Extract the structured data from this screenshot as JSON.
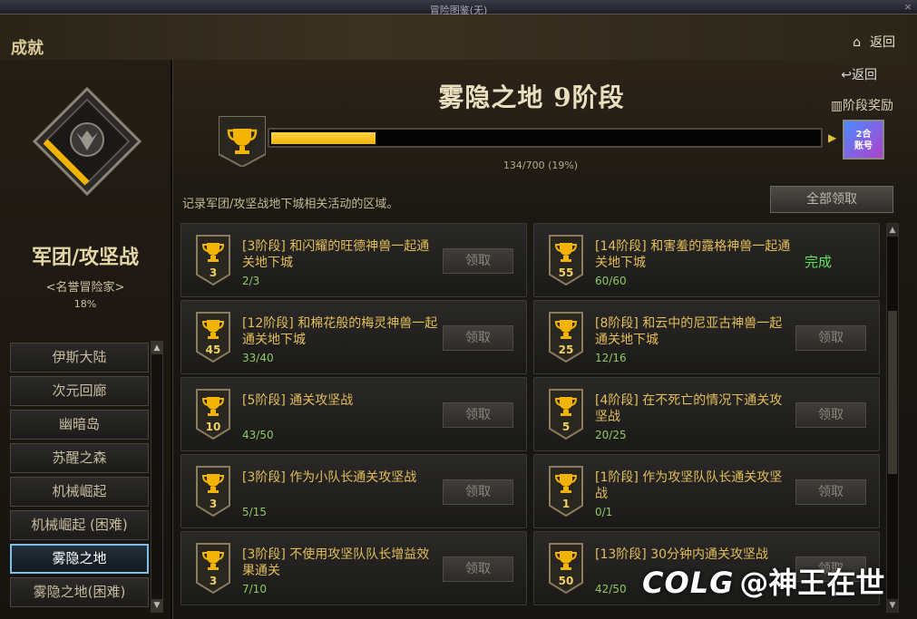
{
  "window": {
    "title": "冒险图鉴(无)",
    "close": "×"
  },
  "header": {
    "section_title": "成就",
    "home_label": "返回",
    "home_icon": "home-icon"
  },
  "category": {
    "title": "军团/攻坚战",
    "subtitle": "<名誉冒险家>",
    "percent": "18%",
    "items": [
      {
        "label": "伊斯大陆",
        "active": false
      },
      {
        "label": "次元回廊",
        "active": false
      },
      {
        "label": "幽暗岛",
        "active": false
      },
      {
        "label": "苏醒之森",
        "active": false
      },
      {
        "label": "机械崛起",
        "active": false
      },
      {
        "label": "机械崛起 (困难)",
        "active": false
      },
      {
        "label": "雾隐之地",
        "active": true
      },
      {
        "label": "雾隐之地(困难)",
        "active": false
      }
    ]
  },
  "main": {
    "back_label": "返回",
    "stage_title": "雾隐之地  9阶段",
    "stage_reward_label": "阶段奖励",
    "progress_text": "134/700 (19%)",
    "progress_fraction": 0.19,
    "reward_box_label": "2合\n账号",
    "description": "记录军团/攻坚战地下城相关活动的区域。",
    "claim_all_label": "全部领取",
    "accent_color": "#f2b400"
  },
  "achievements": [
    {
      "badge": "3",
      "name": "[3阶段] 和闪耀的旺德神兽一起通关地下城",
      "count": "2/3",
      "action": "领取"
    },
    {
      "badge": "55",
      "name": "[14阶段] 和害羞的露格神兽一起通关地下城",
      "count": "60/60",
      "action": "完成"
    },
    {
      "badge": "45",
      "name": "[12阶段] 和棉花般的梅灵神兽一起通关地下城",
      "count": "33/40",
      "action": "领取"
    },
    {
      "badge": "25",
      "name": "[8阶段] 和云中的尼亚古神兽一起通关地下城",
      "count": "12/16",
      "action": "领取"
    },
    {
      "badge": "10",
      "name": "[5阶段] 通关攻坚战",
      "count": "43/50",
      "action": "领取"
    },
    {
      "badge": "5",
      "name": "[4阶段] 在不死亡的情况下通关攻坚战",
      "count": "20/25",
      "action": "领取"
    },
    {
      "badge": "3",
      "name": "[3阶段] 作为小队长通关攻坚战",
      "count": "5/15",
      "action": "领取"
    },
    {
      "badge": "1",
      "name": "[1阶段] 作为攻坚队队长通关攻坚战",
      "count": "0/1",
      "action": "领取"
    },
    {
      "badge": "3",
      "name": "[3阶段] 不使用攻坚队队长增益效果通关",
      "count": "7/10",
      "action": "领取"
    },
    {
      "badge": "50",
      "name": "[13阶段] 30分钟内通关攻坚战",
      "count": "42/50",
      "action": "领取"
    }
  ],
  "watermark": {
    "logo": "COLG",
    "text": "@神王在世"
  }
}
